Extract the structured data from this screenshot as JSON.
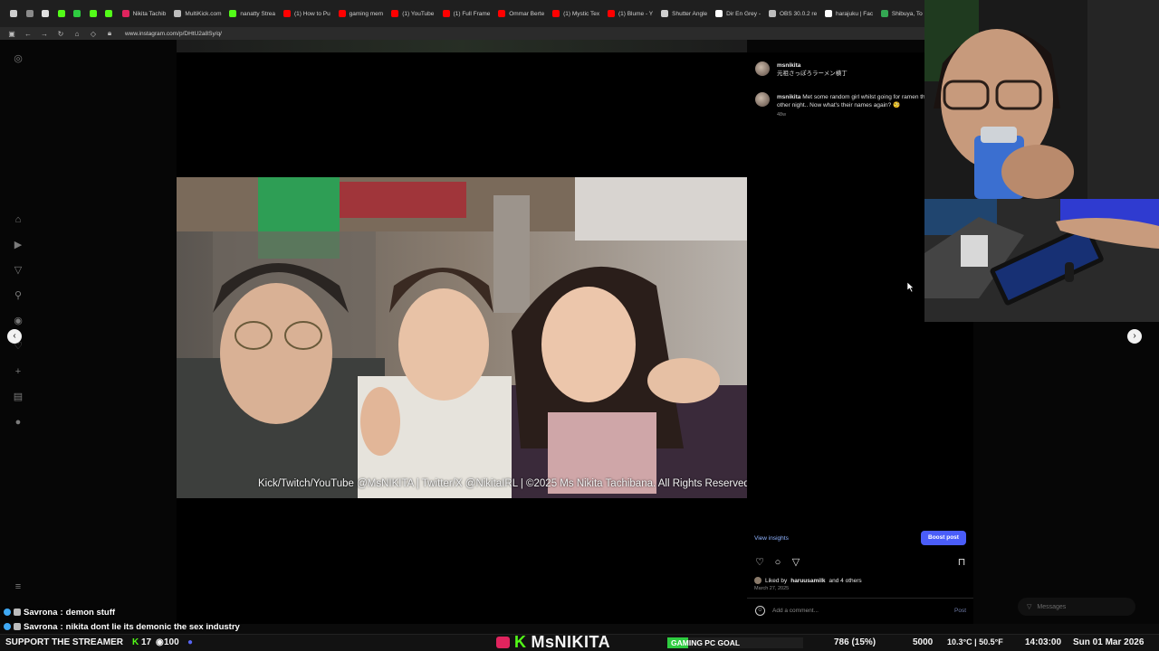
{
  "browser": {
    "tabs": [
      {
        "label": "",
        "color": "#cfcfcf"
      },
      {
        "label": "",
        "color": "#8a8a8a"
      },
      {
        "label": "",
        "color": "#e0e0e0"
      },
      {
        "label": "",
        "color": "#53fc18"
      },
      {
        "label": "",
        "color": "#2ecc40"
      },
      {
        "label": "",
        "color": "#53fc18"
      },
      {
        "label": "",
        "color": "#53fc18"
      },
      {
        "label": "Nikita Tachib",
        "color": "#e0245e"
      },
      {
        "label": "MultiKick.com",
        "color": "#bdbdbd"
      },
      {
        "label": "nanatty Strea",
        "color": "#53fc18"
      },
      {
        "label": "(1) How to Pu",
        "color": "#ff0000"
      },
      {
        "label": "gaming mem",
        "color": "#ff0000"
      },
      {
        "label": "(1) YouTube",
        "color": "#ff0000"
      },
      {
        "label": "(1) Full Frame",
        "color": "#ff0000"
      },
      {
        "label": "Ommar Berte",
        "color": "#ff0000"
      },
      {
        "label": "(1) Mystic Tex",
        "color": "#ff0000"
      },
      {
        "label": "(1) Blume - Y",
        "color": "#ff0000"
      },
      {
        "label": "Shutter Angle",
        "color": "#cfcfcf"
      },
      {
        "label": "Dir En Grey -",
        "color": "#ffffff"
      },
      {
        "label": "OBS 30.0.2 re",
        "color": "#bdbdbd"
      },
      {
        "label": "harajuku | Fac",
        "color": "#ffffff"
      },
      {
        "label": "Shibuya, To",
        "color": "#34a853"
      }
    ],
    "url": "www.instagram.com/p/DHtU2a8Sy/q/"
  },
  "post": {
    "watermark": "Kick/Twitch/YouTube @MsNIKITA | Twitter/X @NikitaIRL | ©2025 Ms Nikita Tachibana. All Rights Reserved."
  },
  "comments": {
    "header_user": "msnikita",
    "header_location": "元祖さっぽろラーメン横丁",
    "caption_user": "msnikita",
    "caption_text_1": "Met some random girl whilst going for ramen the",
    "caption_text_2": "other night.. Now what's their names again? 🧐",
    "caption_age": "48w",
    "view_insights": "View insights",
    "boost_post": "Boost post",
    "liked_by_prefix": "Liked by",
    "liked_by_user": "haruusamilk",
    "liked_by_suffix": "and 4 others",
    "date": "March 27, 2025",
    "add_comment_placeholder": "Add a comment...",
    "post_label": "Post",
    "messages_label": "Messages"
  },
  "chat": [
    {
      "user": "Savrona",
      "message": "demon stuff"
    },
    {
      "user": "Savrona",
      "message": "nikita dont lie its demonic the sex industry"
    }
  ],
  "ticker": {
    "support_label": "SUPPORT THE STREAMER",
    "kick_count": "17",
    "other_count": "100",
    "brand": "MsNIKITA",
    "goal_label": "GAMING PC GOAL",
    "goal_progress": 0.15,
    "goal_amount": "786 (15%)",
    "goal_target": "5000",
    "weather": "10.3°C | 50.5°F",
    "time": "14:03:00",
    "date": "Sun 01 Mar 2026"
  },
  "colors": {
    "kick_green": "#53fc18",
    "ig_blue": "#4a5df9",
    "link_blue": "#8fb3ff"
  }
}
